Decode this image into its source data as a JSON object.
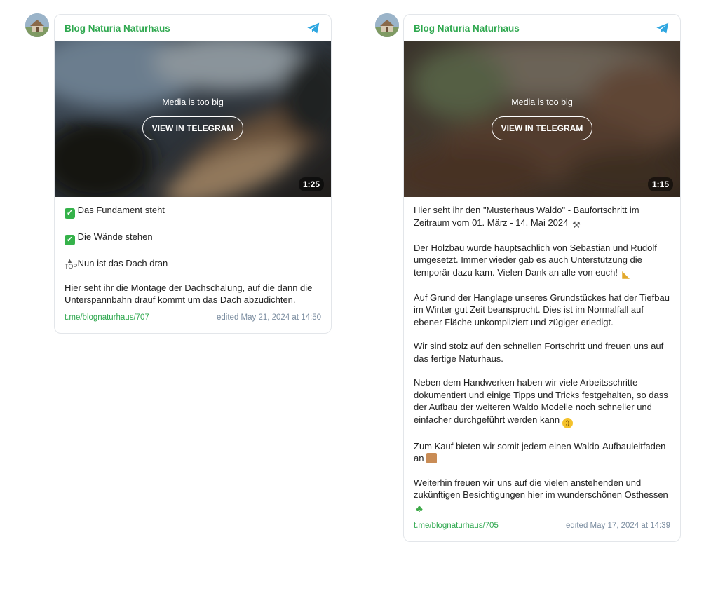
{
  "posts": [
    {
      "channel_name": "Blog Naturia Naturhaus",
      "media_message": "Media is too big",
      "view_button": "VIEW IN TELEGRAM",
      "duration": "1:25",
      "lines": [
        "Das Fundament steht",
        "Die Wände stehen",
        "Nun ist das Dach dran",
        "Hier seht ihr die Montage der Dachschalung, auf die dann die Unterspannbahn drauf kommt um das Dach abzudichten."
      ],
      "link": "t.me/blognaturhaus/707",
      "edited": "edited  May 21, 2024 at 14:50"
    },
    {
      "channel_name": "Blog Naturia Naturhaus",
      "media_message": "Media is too big",
      "view_button": "VIEW IN TELEGRAM",
      "duration": "1:15",
      "paragraphs": [
        "Hier seht ihr den \"Musterhaus Waldo\" - Baufortschritt im Zeitraum vom 01. März - 14. Mai 2024",
        "Der Holzbau wurde hauptsächlich von Sebastian und Rudolf umgesetzt. Immer wieder gab es auch Unterstützung die temporär dazu kam. Vielen Dank an alle von euch!",
        "Auf Grund der Hanglage unseres Grundstückes hat der Tiefbau im Winter gut Zeit beansprucht. Dies ist im Normalfall auf ebener Fläche unkompliziert und zügiger erledigt.",
        "Wir sind stolz auf den schnellen Fortschritt und freuen uns auf das fertige Naturhaus.",
        "Neben dem Handwerken haben wir viele Arbeitsschritte dokumentiert und einige Tipps und Tricks festgehalten, so dass der Aufbau der weiteren Waldo Modelle noch schneller und einfacher durchgeführt werden kann",
        "Zum Kauf bieten wir somit jedem einen Waldo-Aufbauleitfaden an",
        "Weiterhin freuen wir uns auf die vielen anstehenden und zukünftigen Besichtigungen hier im wunderschönen Osthessen"
      ],
      "link": "t.me/blognaturhaus/705",
      "edited": "edited  May 17, 2024 at 14:39"
    }
  ],
  "icons": {
    "telegram": "telegram-icon",
    "check": "check-mark-icon",
    "top": "top-arrow-icon",
    "tools": "hammer-pick-icon",
    "arm": "flexed-biceps-icon",
    "wink": "winking-face-icon",
    "scroll": "scroll-icon",
    "clover": "four-leaf-clover-icon"
  },
  "colors": {
    "channel": "#2fa84f",
    "link": "#2fa84f",
    "edited": "#7b8da0",
    "telegram": "#2ea6e0"
  }
}
